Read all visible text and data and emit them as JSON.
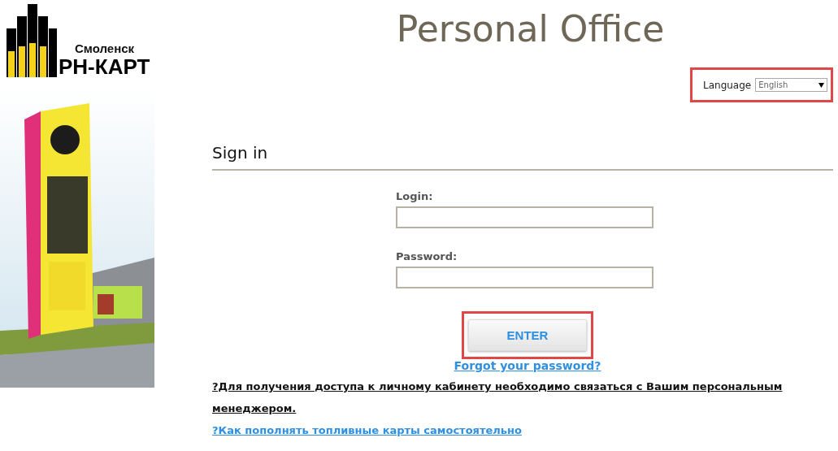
{
  "logo": {
    "city": "Смоленск",
    "brand": "РН-КАРТ"
  },
  "title": "Personal Office",
  "language": {
    "label": "Language",
    "value": "English",
    "highlighted": true
  },
  "sign_in": {
    "heading": "Sign in",
    "fields": [
      {
        "label": "Login:"
      },
      {
        "label": "Password:"
      }
    ],
    "enter_button": {
      "label": "ENTER",
      "highlighted": true
    },
    "forgot_link": "Forgot your password?"
  },
  "notices": [
    {
      "kind": "note",
      "text": "?Для получения доступа к личному кабинету необходимо связаться с Вашим персональным менеджером."
    },
    {
      "kind": "link",
      "text": "?Как пополнять топливные карты самостоятельно"
    }
  ]
}
